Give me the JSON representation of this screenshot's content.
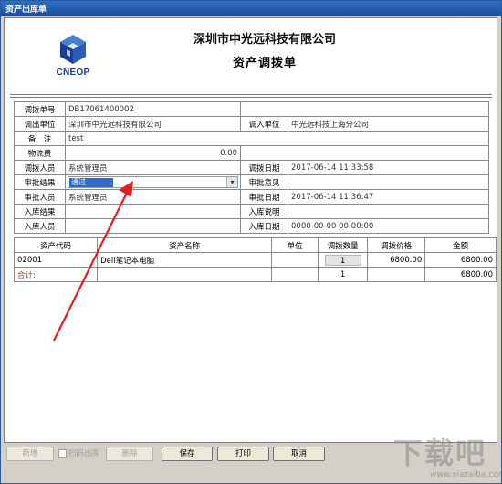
{
  "window": {
    "title": "资产出库单"
  },
  "header": {
    "logo_text": "CNEOP",
    "company": "深圳市中光远科技有限公司",
    "doc_title": "资产调拨单"
  },
  "form": {
    "transfer_no_label": "调拨单号",
    "transfer_no": "DB17061400002",
    "out_unit_label": "调出单位",
    "out_unit": "深圳市中光远科技有限公司",
    "in_unit_label": "调入单位",
    "in_unit": "中光远科技上海分公司",
    "remark_label": "备　注",
    "remark": "test",
    "logistics_label": "物流费",
    "logistics": "0.00",
    "transfer_person_label": "调拨人员",
    "transfer_person": "系统管理员",
    "transfer_date_label": "调拨日期",
    "transfer_date": "2017-06-14 11:33:58",
    "audit_result_label": "审批结果",
    "audit_result": "通过",
    "audit_opinion_label": "审批意见",
    "audit_opinion": "",
    "auditor_label": "审批人员",
    "auditor": "系统管理员",
    "audit_date_label": "审批日期",
    "audit_date": "2017-06-14 11:36:47",
    "storage_result_label": "入库结果",
    "storage_result": "",
    "storage_note_label": "入库说明",
    "storage_note": "",
    "storage_person_label": "入库人员",
    "storage_person": "",
    "storage_date_label": "入库日期",
    "storage_date": "0000-00-00 00:00:00"
  },
  "items": {
    "headers": [
      "资产代码",
      "资产名称",
      "单位",
      "调拨数量",
      "调拨价格",
      "金额"
    ],
    "rows": [
      {
        "code": "02001",
        "name": "Dell笔记本电脑",
        "unit": "",
        "qty": "1",
        "price": "6800.00",
        "amount": "6800.00"
      }
    ],
    "total_label": "合计:",
    "total_qty": "1",
    "total_amount": "6800.00"
  },
  "toolbar": {
    "add": "新增",
    "scan_out": "扫码出库",
    "delete": "删除",
    "save": "保存",
    "print": "打印",
    "cancel": "取消"
  },
  "watermark": {
    "main": "下载吧",
    "sub": "www.xiazaiba.com"
  },
  "colors": {
    "titlebar": "#1b4f9e",
    "selection": "#316ac5",
    "arrow": "#e02020"
  }
}
